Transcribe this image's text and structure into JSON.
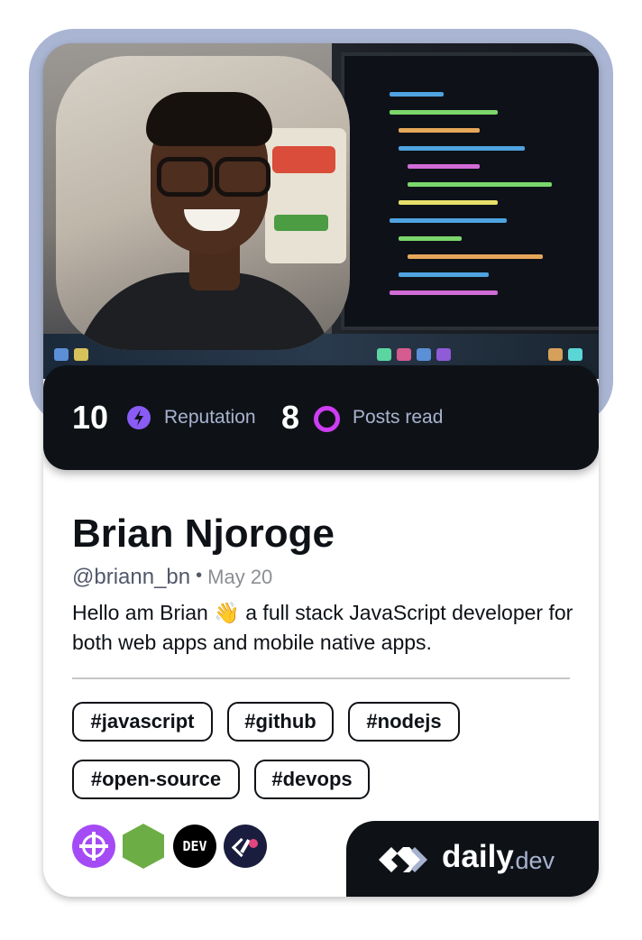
{
  "profile": {
    "name": "Brian Njoroge",
    "handle": "@briann_bn",
    "joined": "May 20",
    "bio": "Hello am Brian 👋 a full stack JavaScript developer for both web apps and mobile native apps."
  },
  "stats": {
    "reputation_value": "10",
    "reputation_label": "Reputation",
    "posts_value": "8",
    "posts_label": "Posts read"
  },
  "tags": [
    "#javascript",
    "#github",
    "#nodejs",
    "#open-source",
    "#devops"
  ],
  "sources": [
    {
      "icon": "crosshair-source-icon",
      "color": "#a54bf5"
    },
    {
      "icon": "nodejs-source-icon",
      "color": "#6cae45"
    },
    {
      "icon": "dev-source-icon",
      "label": "DEV",
      "color": "#000000"
    },
    {
      "icon": "code-source-icon",
      "color": "#1b1d3f"
    }
  ],
  "brand": {
    "name": "daily",
    "tld": ".dev"
  },
  "colors": {
    "frame": "#a9b5d3",
    "dark": "#0e1217",
    "reputation_icon": "#8a5cf5",
    "posts_icon": "#ce3df3",
    "muted": "#a8b3cf"
  }
}
